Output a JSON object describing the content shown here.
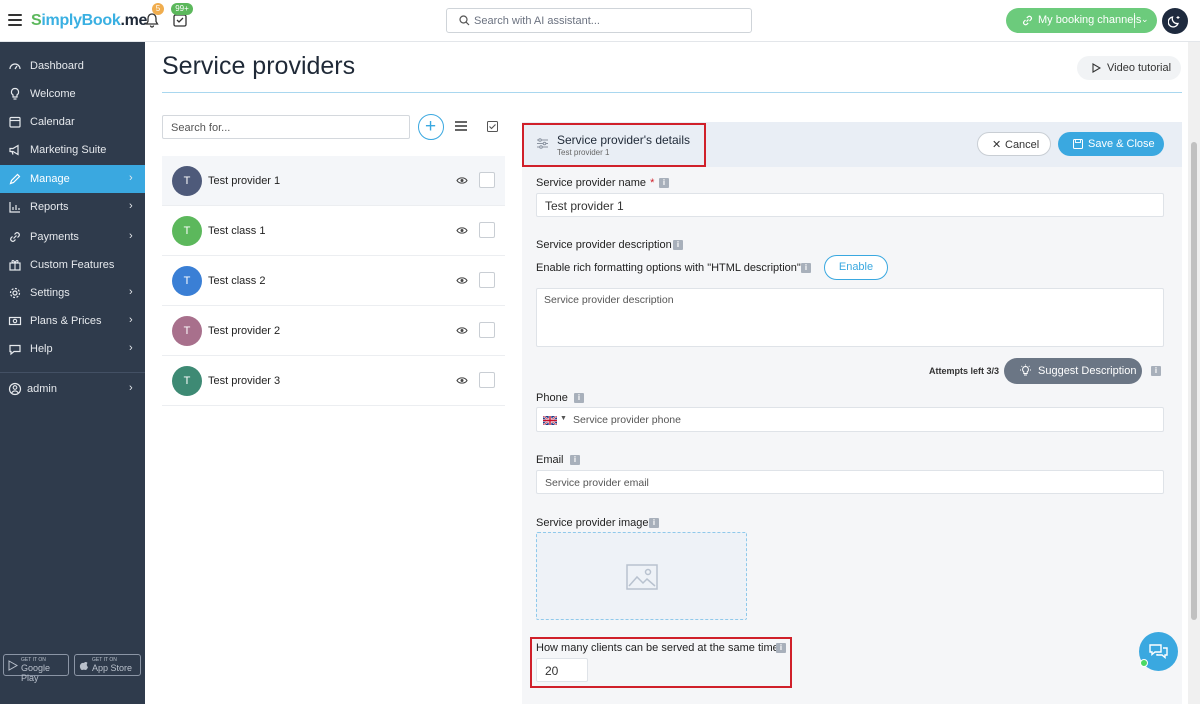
{
  "app": {
    "logo_s": "S",
    "logo_simply": "implyBook",
    "logo_me": ".me",
    "notifications_count": "5",
    "tasks_count": "99+",
    "search_placeholder": "Search with AI assistant...",
    "booking_channels": "My booking channels"
  },
  "sidebar": {
    "items": [
      {
        "label": "Dashboard",
        "icon": "gauge-icon"
      },
      {
        "label": "Welcome",
        "icon": "lightbulb-icon"
      },
      {
        "label": "Calendar",
        "icon": "calendar-icon"
      },
      {
        "label": "Marketing Suite",
        "icon": "megaphone-icon"
      },
      {
        "label": "Manage",
        "icon": "pencil-icon",
        "active": true
      },
      {
        "label": "Reports",
        "icon": "chart-icon"
      },
      {
        "label": "Payments",
        "icon": "link-icon"
      },
      {
        "label": "Custom Features",
        "icon": "gift-icon"
      },
      {
        "label": "Settings",
        "icon": "gear-icon"
      },
      {
        "label": "Plans & Prices",
        "icon": "money-icon"
      },
      {
        "label": "Help",
        "icon": "chat-bubble-icon"
      }
    ],
    "user": "admin",
    "google_play_small": "GET IT ON",
    "google_play": "Google Play",
    "app_store_small": "GET IT ON",
    "app_store": "App Store"
  },
  "page": {
    "title": "Service providers",
    "video_tutorial": "Video tutorial"
  },
  "list": {
    "search_placeholder": "Search for...",
    "providers": [
      {
        "initial": "T",
        "name": "Test provider 1",
        "color": "#4e5a7a"
      },
      {
        "initial": "T",
        "name": "Test class 1",
        "color": "#5cb85c"
      },
      {
        "initial": "T",
        "name": "Test class 2",
        "color": "#3a7fd5"
      },
      {
        "initial": "T",
        "name": "Test provider 2",
        "color": "#a8708c"
      },
      {
        "initial": "T",
        "name": "Test provider 3",
        "color": "#3e8a74"
      }
    ]
  },
  "details": {
    "title": "Service provider's details",
    "subtitle": "Test provider 1",
    "cancel": "Cancel",
    "save_close": "Save & Close",
    "name_label": "Service provider name",
    "name_required": "*",
    "name_value": "Test provider 1",
    "description_label": "Service provider description",
    "rich_formatting_label": "Enable rich formatting options with \"HTML description\"?",
    "enable": "Enable",
    "description_placeholder": "Service provider description",
    "attempts": "Attempts left 3/3",
    "suggest": "Suggest Description",
    "phone_label": "Phone",
    "phone_placeholder": "Service provider phone",
    "email_label": "Email",
    "email_placeholder": "Service provider email",
    "image_label": "Service provider image",
    "clients_label": "How many clients can be served at the same time?",
    "clients_value": "20",
    "info_glyph": "i"
  },
  "colors": {
    "accent": "#3aa8e0",
    "sidebar_bg": "#2f3b4c",
    "highlight_border": "#d0202a",
    "booking_green": "#6ccb7c"
  }
}
